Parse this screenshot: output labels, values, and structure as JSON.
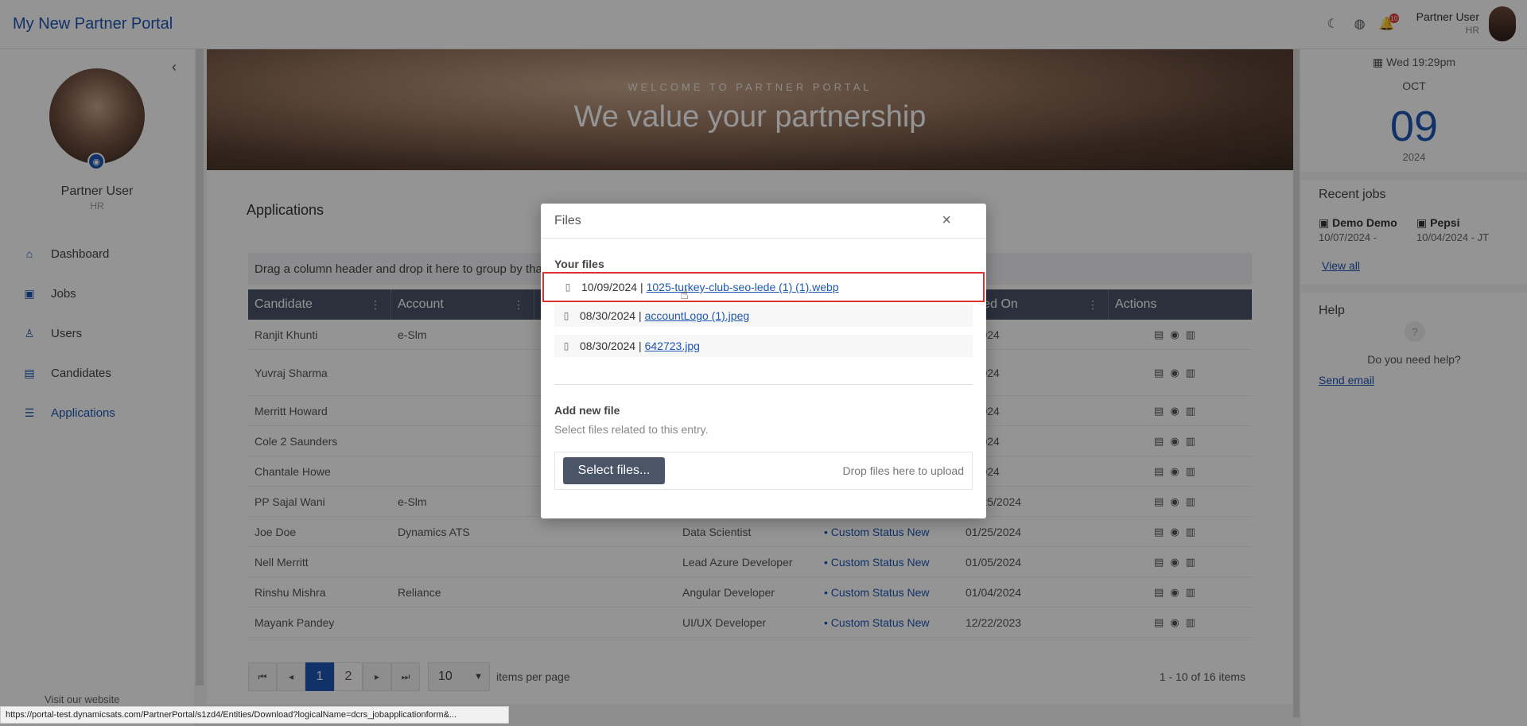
{
  "app": {
    "title": "My New Partner Portal"
  },
  "topbar": {
    "user_name": "Partner User",
    "user_role": "HR",
    "notif_count": "10"
  },
  "sidebar": {
    "user_name": "Partner User",
    "user_role": "HR",
    "items": [
      {
        "label": "Dashboard",
        "icon": "home-icon"
      },
      {
        "label": "Jobs",
        "icon": "briefcase-icon"
      },
      {
        "label": "Users",
        "icon": "user-icon"
      },
      {
        "label": "Candidates",
        "icon": "id-card-icon"
      },
      {
        "label": "Applications",
        "icon": "list-icon"
      }
    ],
    "visit": "Visit our website"
  },
  "hero": {
    "subtitle": "WELCOME TO PARTNER PORTAL",
    "title": "We value your partnership"
  },
  "main": {
    "title": "Applications",
    "group_hint": "Drag a column header and drop it here to group by that column",
    "columns": [
      "Candidate",
      "Account",
      "",
      "",
      "",
      "eated On",
      "Actions"
    ],
    "rows": [
      {
        "candidate": "Ranjit Khunti",
        "account": "e-Slm",
        "job": "",
        "status": "",
        "created": "3/2024"
      },
      {
        "candidate": "Yuvraj Sharma",
        "account": "",
        "job": "",
        "status": "",
        "created": "3/2024"
      },
      {
        "candidate": "Merritt Howard",
        "account": "",
        "job": "",
        "status": "",
        "created": "9/2024"
      },
      {
        "candidate": "Cole 2 Saunders",
        "account": "",
        "job": "",
        "status": "",
        "created": "9/2024"
      },
      {
        "candidate": "Chantale Howe",
        "account": "",
        "job": "",
        "status": "",
        "created": "3/2024"
      },
      {
        "candidate": "PP Sajal Wani",
        "account": "e-Slm",
        "job": "React Native",
        "status": "Custom Status New",
        "created": "01/25/2024"
      },
      {
        "candidate": "Joe Doe",
        "account": "Dynamics ATS",
        "job": "Data Scientist",
        "status": "Custom Status New",
        "created": "01/25/2024"
      },
      {
        "candidate": "Nell Merritt",
        "account": "",
        "job": "Lead Azure Developer",
        "status": "Custom Status New",
        "created": "01/05/2024"
      },
      {
        "candidate": "Rinshu Mishra",
        "account": "Reliance",
        "job": "Angular Developer",
        "status": "Custom Status New",
        "created": "01/04/2024"
      },
      {
        "candidate": "Mayank Pandey",
        "account": "",
        "job": "UI/UX Developer",
        "status": "Custom Status New",
        "created": "12/22/2023"
      }
    ],
    "pager": {
      "pages": [
        "1",
        "2"
      ],
      "per_page": "10",
      "per_page_label": "items per page",
      "range": "1 - 10 of 16 items"
    }
  },
  "right": {
    "date_line": "Wed 19:29pm",
    "month": "OCT",
    "day": "09",
    "year": "2024",
    "recent_title": "Recent jobs",
    "jobs": [
      {
        "title": "Demo Demo",
        "date": "10/07/2024 -"
      },
      {
        "title": "Pepsi",
        "date": "10/04/2024 - JT"
      }
    ],
    "view_all": "View all",
    "help_title": "Help",
    "help_text": "Do you need help?",
    "send_email": "Send email"
  },
  "modal": {
    "title": "Files",
    "your_files": "Your files",
    "files": [
      {
        "date": "10/09/2024 |",
        "name": "1025-turkey-club-seo-lede (1) (1).webp"
      },
      {
        "date": "08/30/2024 |",
        "name": "accountLogo (1).jpeg"
      },
      {
        "date": "08/30/2024 |",
        "name": "642723.jpg"
      }
    ],
    "add_new": "Add new file",
    "hint": "Select files related to this entry.",
    "select_btn": "Select files...",
    "drop": "Drop files here to upload"
  },
  "status_url": "https://portal-test.dynamicsats.com/PartnerPortal/s1zd4/Entities/Download?logicalName=dcrs_jobapplicationform&..."
}
